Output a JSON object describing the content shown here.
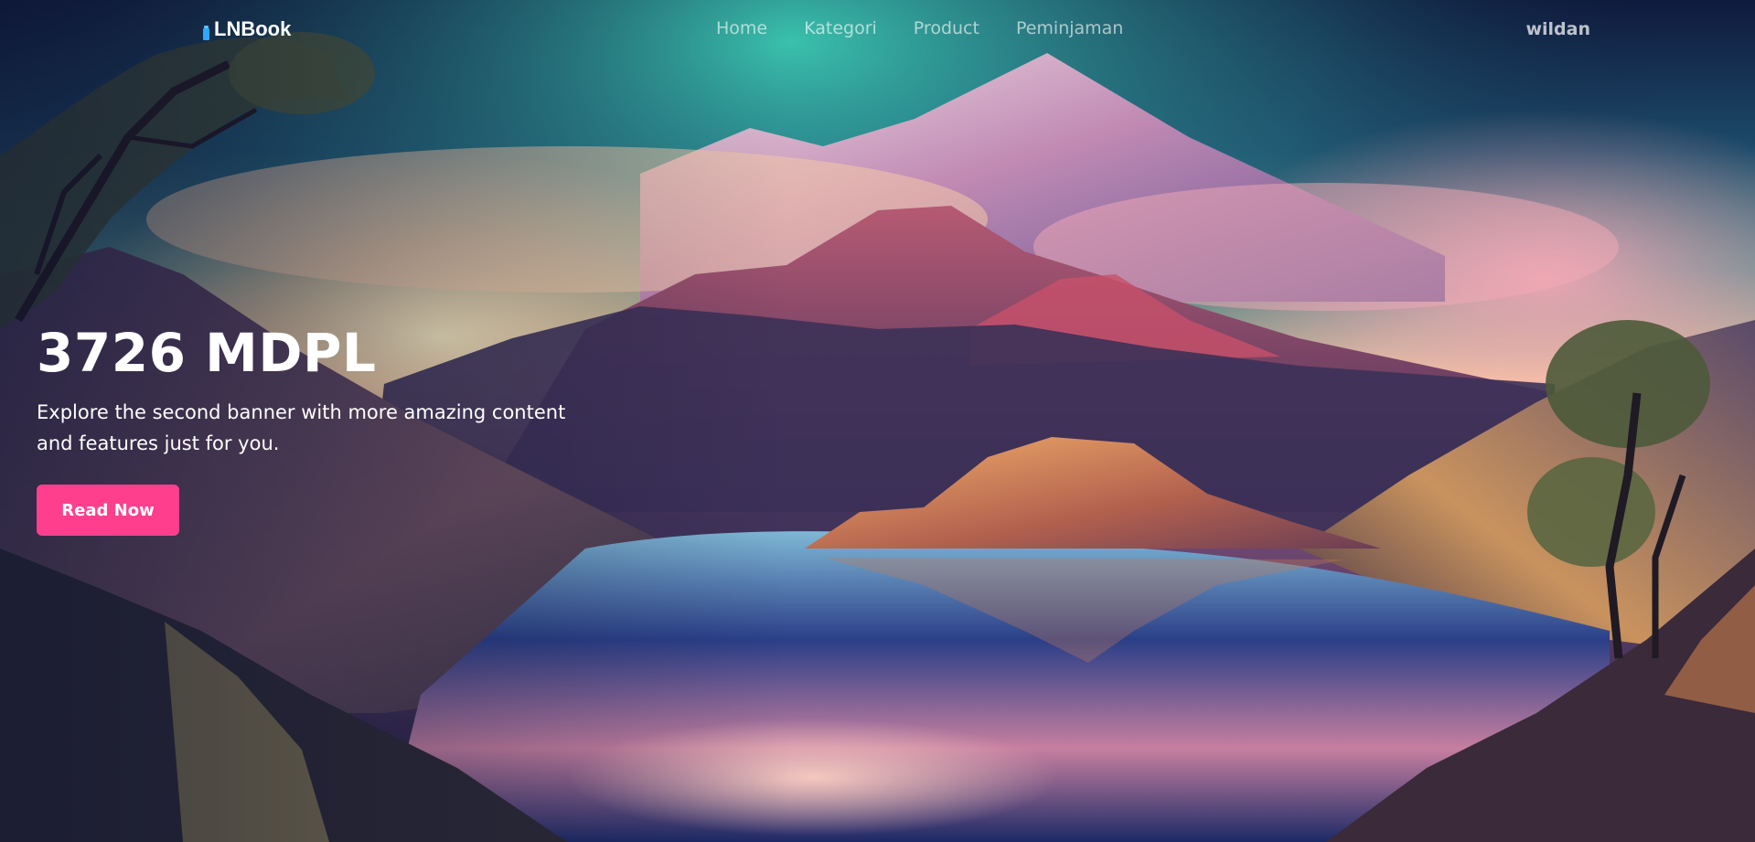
{
  "navbar": {
    "brand": "LNBook",
    "links": [
      "Home",
      "Kategori",
      "Product",
      "Peminjaman"
    ],
    "user": "wildan"
  },
  "banner": {
    "title": "3726 MDPL",
    "description": "Explore the second banner with more amazing content and features just for you.",
    "button_label": "Read Now"
  },
  "colors": {
    "accent": "#ff3f8e",
    "brand_icon": "#2ea8ff",
    "sky_top": "#0d1330",
    "aurora": "#3fc6b2",
    "lake": "#2a3f8c"
  },
  "icons": {
    "brand": "book-icon"
  }
}
